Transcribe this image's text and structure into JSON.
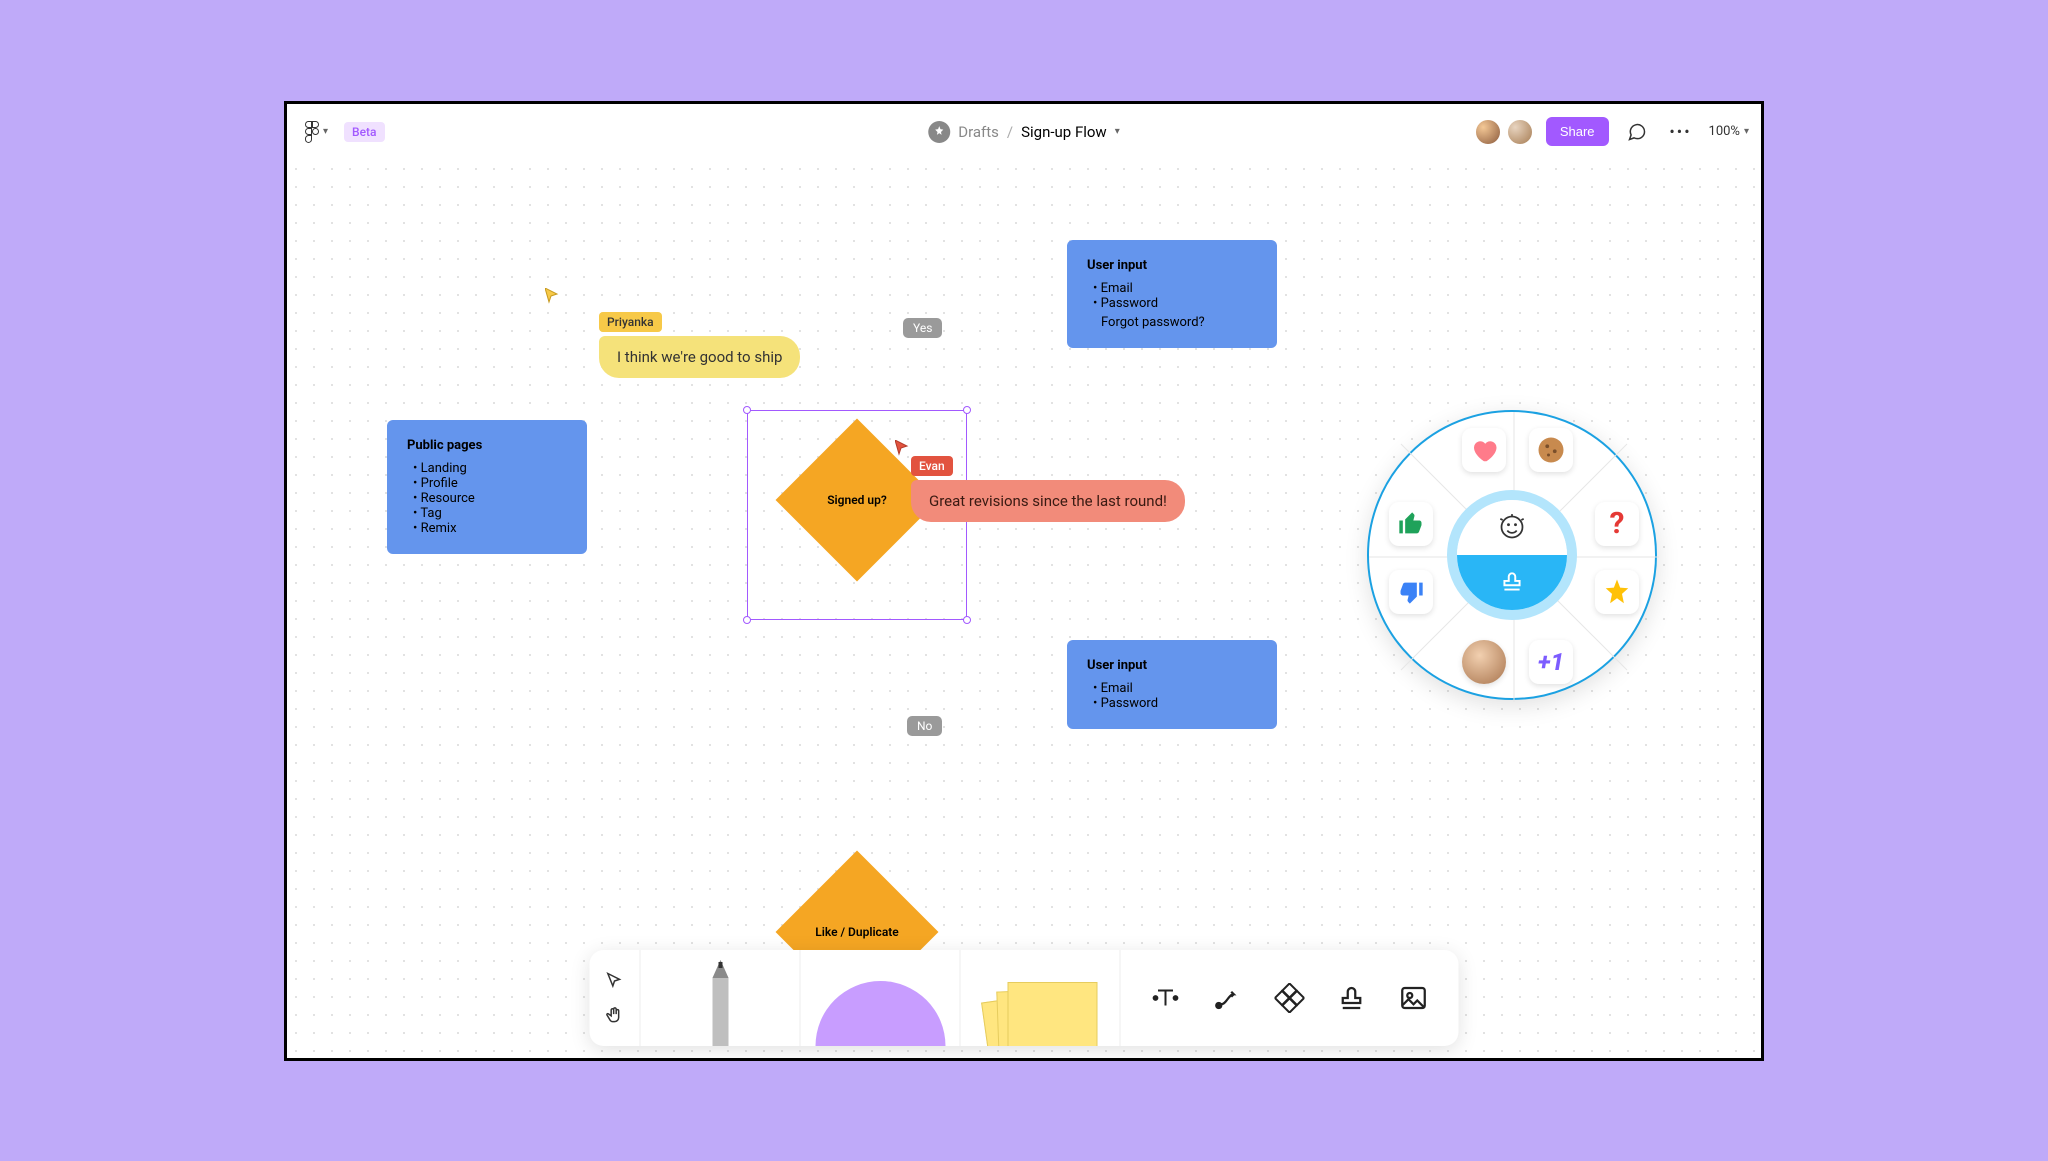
{
  "header": {
    "badge": "Beta",
    "breadcrumb_parent": "Drafts",
    "breadcrumb_title": "Sign-up Flow",
    "share_label": "Share",
    "zoom": "100%"
  },
  "nodes": {
    "public_pages": {
      "title": "Public pages",
      "items": [
        "Landing",
        "Profile",
        "Resource",
        "Tag",
        "Remix"
      ]
    },
    "signed_up": {
      "label": "Signed up?"
    },
    "like_duplicate": {
      "label": "Like / Duplicate"
    },
    "user_input_top": {
      "title": "User input",
      "items": [
        "Email",
        "Password"
      ],
      "extra": "Forgot password?"
    },
    "user_input_bottom": {
      "title": "User input",
      "items": [
        "Email",
        "Password"
      ]
    }
  },
  "connectors": {
    "yes": "Yes",
    "no": "No"
  },
  "cursors": {
    "priyanka": {
      "name": "Priyanka",
      "message": "I think we're good to ship"
    },
    "evan": {
      "name": "Evan",
      "message": "Great revisions since the last round!"
    }
  },
  "wheel": {
    "items": [
      "heart-icon",
      "cookie-icon",
      "thumbs-up-icon",
      "question-icon",
      "thumbs-down-icon",
      "star-icon",
      "avatar-icon",
      "plus-one-icon"
    ],
    "plus_one": "+1"
  },
  "toolbar": {
    "select": "select-tool",
    "hand": "hand-tool",
    "pencil": "pencil-tool",
    "shape": "shape-tool",
    "sticky": "sticky-tool",
    "text": "text-tool",
    "connector": "connector-tool",
    "diamond": "diamond-tool",
    "stamp": "stamp-tool",
    "image": "image-tool"
  }
}
